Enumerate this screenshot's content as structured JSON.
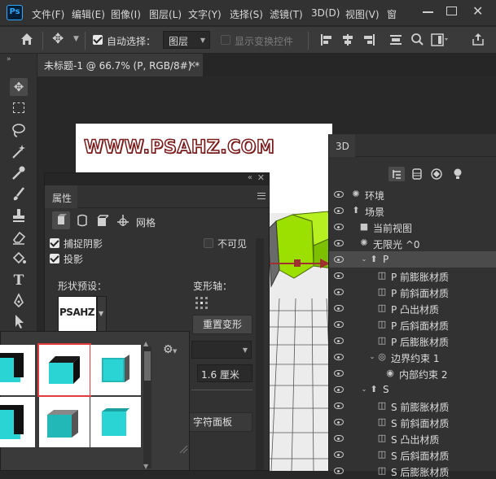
{
  "app": {
    "logo": "Ps"
  },
  "menu": [
    "文件(F)",
    "编辑(E)",
    "图像(I)",
    "图层(L)",
    "文字(Y)",
    "选择(S)",
    "滤镜(T)",
    "3D(D)",
    "视图(V)",
    "窗"
  ],
  "options": {
    "auto_select_label": "自动选择：",
    "auto_select_target": "图层",
    "show_transform_label": "显示变换控件"
  },
  "document": {
    "tab_title": "未标题-1 @ 66.7% (P, RGB/8#) *"
  },
  "canvas": {
    "watermark": "WWW.PSAHZ.COM"
  },
  "properties": {
    "title": "属性",
    "mesh_tab": "网格",
    "catch_shadows": "捕捉阴影",
    "cast_shadows": "投影",
    "invisible": "不可见",
    "shape_preset_label": "形状预设：",
    "preset_preview_text": "PSAHZ",
    "deform_axis_label": "变形轴：",
    "reset_deform": "重置变形",
    "depth_value": "1.6 厘米",
    "char_panel": "字符面板"
  },
  "panel3d": {
    "title": "3D",
    "rows": [
      {
        "label": "环境",
        "icon": "sun",
        "indent": 0,
        "selected": false
      },
      {
        "label": "场景",
        "icon": "scene",
        "indent": 0,
        "selected": false
      },
      {
        "label": "当前视图",
        "icon": "camera",
        "indent": 1,
        "selected": false
      },
      {
        "label": "无限光 ^0",
        "icon": "sun",
        "indent": 1,
        "selected": false
      },
      {
        "label": "P",
        "icon": "mesh",
        "indent": 1,
        "selected": true,
        "expander": true
      },
      {
        "label": "P 前膨胀材质",
        "icon": "material",
        "indent": 2,
        "selected": false
      },
      {
        "label": "P 前斜面材质",
        "icon": "material",
        "indent": 2,
        "selected": false
      },
      {
        "label": "P 凸出材质",
        "icon": "material",
        "indent": 2,
        "selected": false
      },
      {
        "label": "P 后斜面材质",
        "icon": "material",
        "indent": 2,
        "selected": false
      },
      {
        "label": "P 后膨胀材质",
        "icon": "material",
        "indent": 2,
        "selected": false
      },
      {
        "label": "边界约束 1",
        "icon": "constraint",
        "indent": 2,
        "selected": false,
        "expander": true
      },
      {
        "label": "内部约束 2",
        "icon": "constraint-inner",
        "indent": 3,
        "selected": false
      },
      {
        "label": "S",
        "icon": "mesh",
        "indent": 1,
        "selected": false,
        "expander": true
      },
      {
        "label": "S 前膨胀材质",
        "icon": "material",
        "indent": 2,
        "selected": false
      },
      {
        "label": "S 前斜面材质",
        "icon": "material",
        "indent": 2,
        "selected": false
      },
      {
        "label": "S 凸出材质",
        "icon": "material",
        "indent": 2,
        "selected": false
      },
      {
        "label": "S 后斜面材质",
        "icon": "material",
        "indent": 2,
        "selected": false
      },
      {
        "label": "S 后膨胀材质",
        "icon": "material",
        "indent": 2,
        "selected": false
      }
    ]
  },
  "colors": {
    "accent_select": "#e03a3a",
    "model_green": "#9be000",
    "cyan_box": "#2ad4d4"
  }
}
